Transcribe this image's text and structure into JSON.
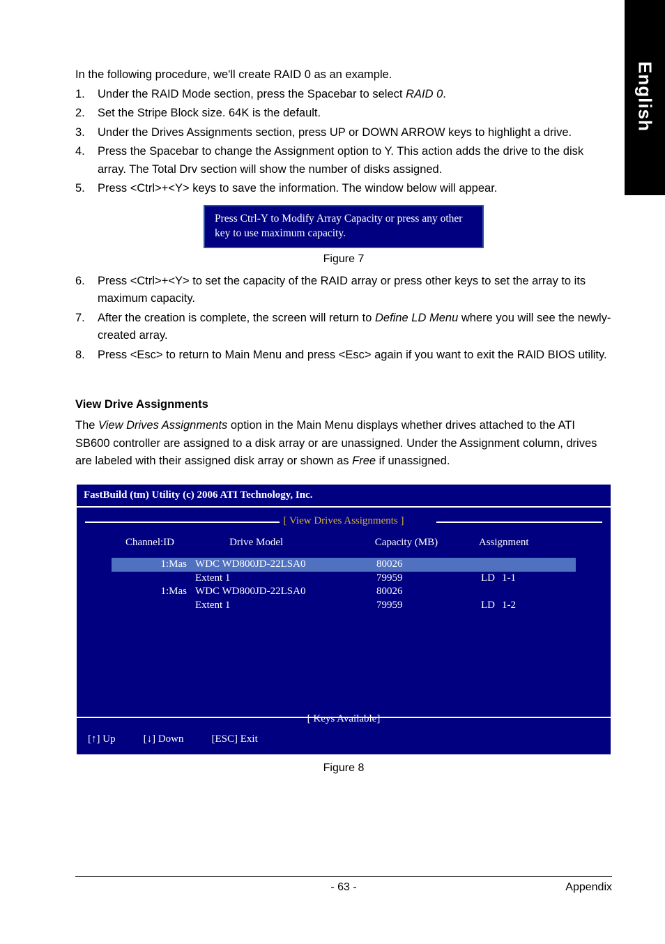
{
  "side_tab": "English",
  "intro": "In the following procedure, we'll create RAID 0 as an example.",
  "steps_a": [
    {
      "n": "1.",
      "pre": "Under the RAID Mode section, press the Spacebar to select ",
      "it": "RAID 0",
      "post": "."
    },
    {
      "n": "2.",
      "pre": "Set the Stripe Block size. 64K is the default.",
      "it": "",
      "post": ""
    },
    {
      "n": "3.",
      "pre": "Under the Drives Assignments section, press UP or DOWN ARROW keys to highlight a drive.",
      "it": "",
      "post": ""
    },
    {
      "n": "4.",
      "pre": "Press the Spacebar to change the Assignment option to Y.  This action adds the drive to the disk array. The Total Drv section will show the number of disks assigned.",
      "it": "",
      "post": ""
    },
    {
      "n": "5.",
      "pre": "Press <Ctrl>+<Y> keys to save the information. The window below will appear.",
      "it": "",
      "post": ""
    }
  ],
  "dialog": "Press Ctrl-Y to Modify Array Capacity or press any other key to use maximum capacity.",
  "fig7": "Figure 7",
  "steps_b": [
    {
      "n": "6.",
      "pre": "Press <Ctrl>+<Y> to set the capacity of the RAID array or press other keys to set the array to its maximum capacity.",
      "it": "",
      "post": ""
    },
    {
      "n": "7.",
      "pre": "After the creation is complete, the screen will return to ",
      "it": "Define LD Menu",
      "post": " where you will see the newly-created array."
    },
    {
      "n": "8.",
      "pre": "Press <Esc> to return to Main Menu and press <Esc> again if you want to exit the RAID BIOS utility.",
      "it": "",
      "post": ""
    }
  ],
  "section_heading": "View Drive Assignments",
  "section_body_pre": "The ",
  "section_body_it": "View Drives Assignments",
  "section_body_mid": " option in the Main Menu displays whether drives attached to the ATI SB600 controller are assigned to a disk array or are unassigned. Under the Assignment column, drives are labeled with their assigned disk array or shown as ",
  "section_body_it2": "Free",
  "section_body_post": " if unassigned.",
  "bios": {
    "title": "FastBuild (tm) Utility (c) 2006 ATI Technology, Inc.",
    "section_label_l": "[ ",
    "section_label_t": "View Drives Assignments",
    "section_label_r": " ]",
    "headers": {
      "ch": "Channel:ID",
      "dm": "Drive Model",
      "cap": "Capacity (MB)",
      "asg": "Assignment"
    },
    "rows": [
      {
        "c1": "1:Mas",
        "c2": "WDC WD800JD-22LSA0",
        "c3": "80026",
        "c4": "",
        "c5": "",
        "hi": true
      },
      {
        "c1": "",
        "c2": "Extent    1",
        "c3": "79959",
        "c4": "LD",
        "c5": "1-1",
        "hi": false
      },
      {
        "c1": "1:Mas",
        "c2": "WDC WD800JD-22LSA0",
        "c3": "80026",
        "c4": "",
        "c5": "",
        "hi": false
      },
      {
        "c1": "",
        "c2": "Extent    1",
        "c3": "79959",
        "c4": "LD",
        "c5": "1-2",
        "hi": false
      }
    ],
    "keys_label_l": "[ ",
    "keys_label_t": "Keys Available",
    "keys_label_r": "]",
    "keys": {
      "up": "[↑] Up",
      "down": "[↓] Down",
      "esc": "[ESC] Exit"
    }
  },
  "fig8": "Figure 8",
  "footer": {
    "page": "- 63 -",
    "section": "Appendix"
  }
}
